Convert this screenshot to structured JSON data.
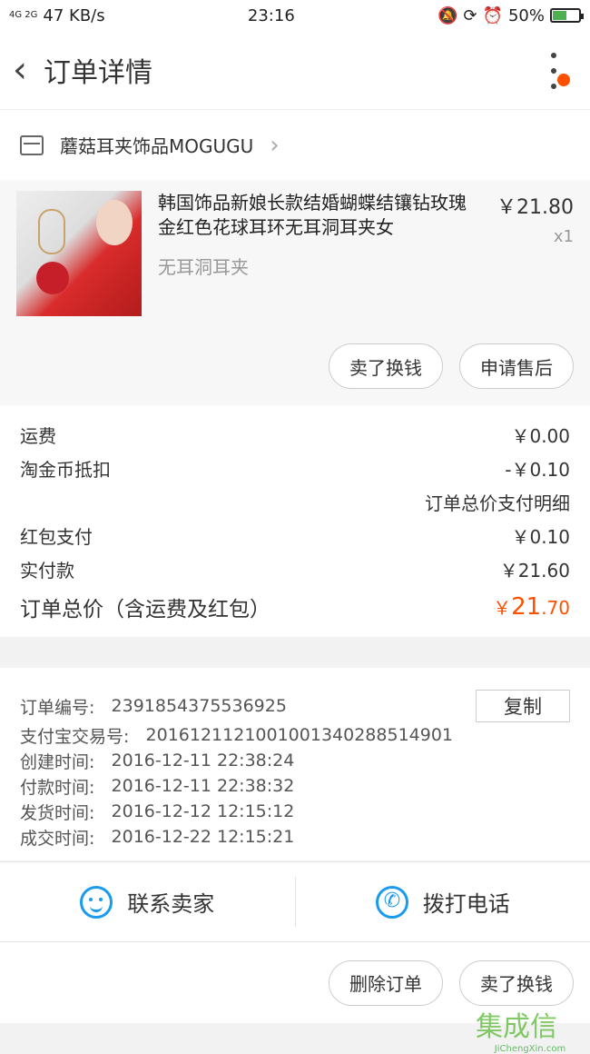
{
  "status_bar": {
    "left_signal": "4G 2G",
    "speed": "47 KB/s",
    "time": "23:16",
    "battery_percent": "50%",
    "battery_level": 0.5
  },
  "header": {
    "title": "订单详情"
  },
  "store": {
    "name": "蘑菇耳夹饰品MOGUGU"
  },
  "product": {
    "name": "韩国饰品新娘长款结婚蝴蝶结镶钻玫瑰金红色花球耳环无耳洞耳夹女",
    "sku": "无耳洞耳夹",
    "price": "￥21.80",
    "qty": "x1",
    "btn_sell": "卖了换钱",
    "btn_aftersale": "申请售后"
  },
  "costs": {
    "shipping_label": "运费",
    "shipping_value": "￥0.00",
    "coin_label": "淘金币抵扣",
    "coin_value": "-￥0.10",
    "detail_link": "订单总价支付明细",
    "redpacket_label": "红包支付",
    "redpacket_value": "￥0.10",
    "paid_label": "实付款",
    "paid_value": "￥21.60",
    "total_label": "订单总价（含运费及红包）",
    "total_symbol": "￥",
    "total_int": "21",
    "total_dec": ".70"
  },
  "order": {
    "number_label": "订单编号:",
    "number_value": "2391854375536925",
    "copy_label": "复制",
    "alipay_label": "支付宝交易号:",
    "alipay_value": "2016121121001001340288514901",
    "created_label": "创建时间:",
    "created_value": "2016-12-11 22:38:24",
    "paid_label": "付款时间:",
    "paid_value": "2016-12-11 22:38:32",
    "shipped_label": "发货时间:",
    "shipped_value": "2016-12-12 12:15:12",
    "done_label": "成交时间:",
    "done_value": "2016-12-22 12:15:21"
  },
  "contact": {
    "seller_label": "联系卖家",
    "phone_label": "拨打电话"
  },
  "footer": {
    "delete_label": "删除订单",
    "sell_label": "卖了换钱"
  },
  "watermark": {
    "text": "集成信",
    "sub": "JiChengXin.com"
  },
  "colors": {
    "accent": "#ff5000",
    "link": "#1a9bf0"
  }
}
